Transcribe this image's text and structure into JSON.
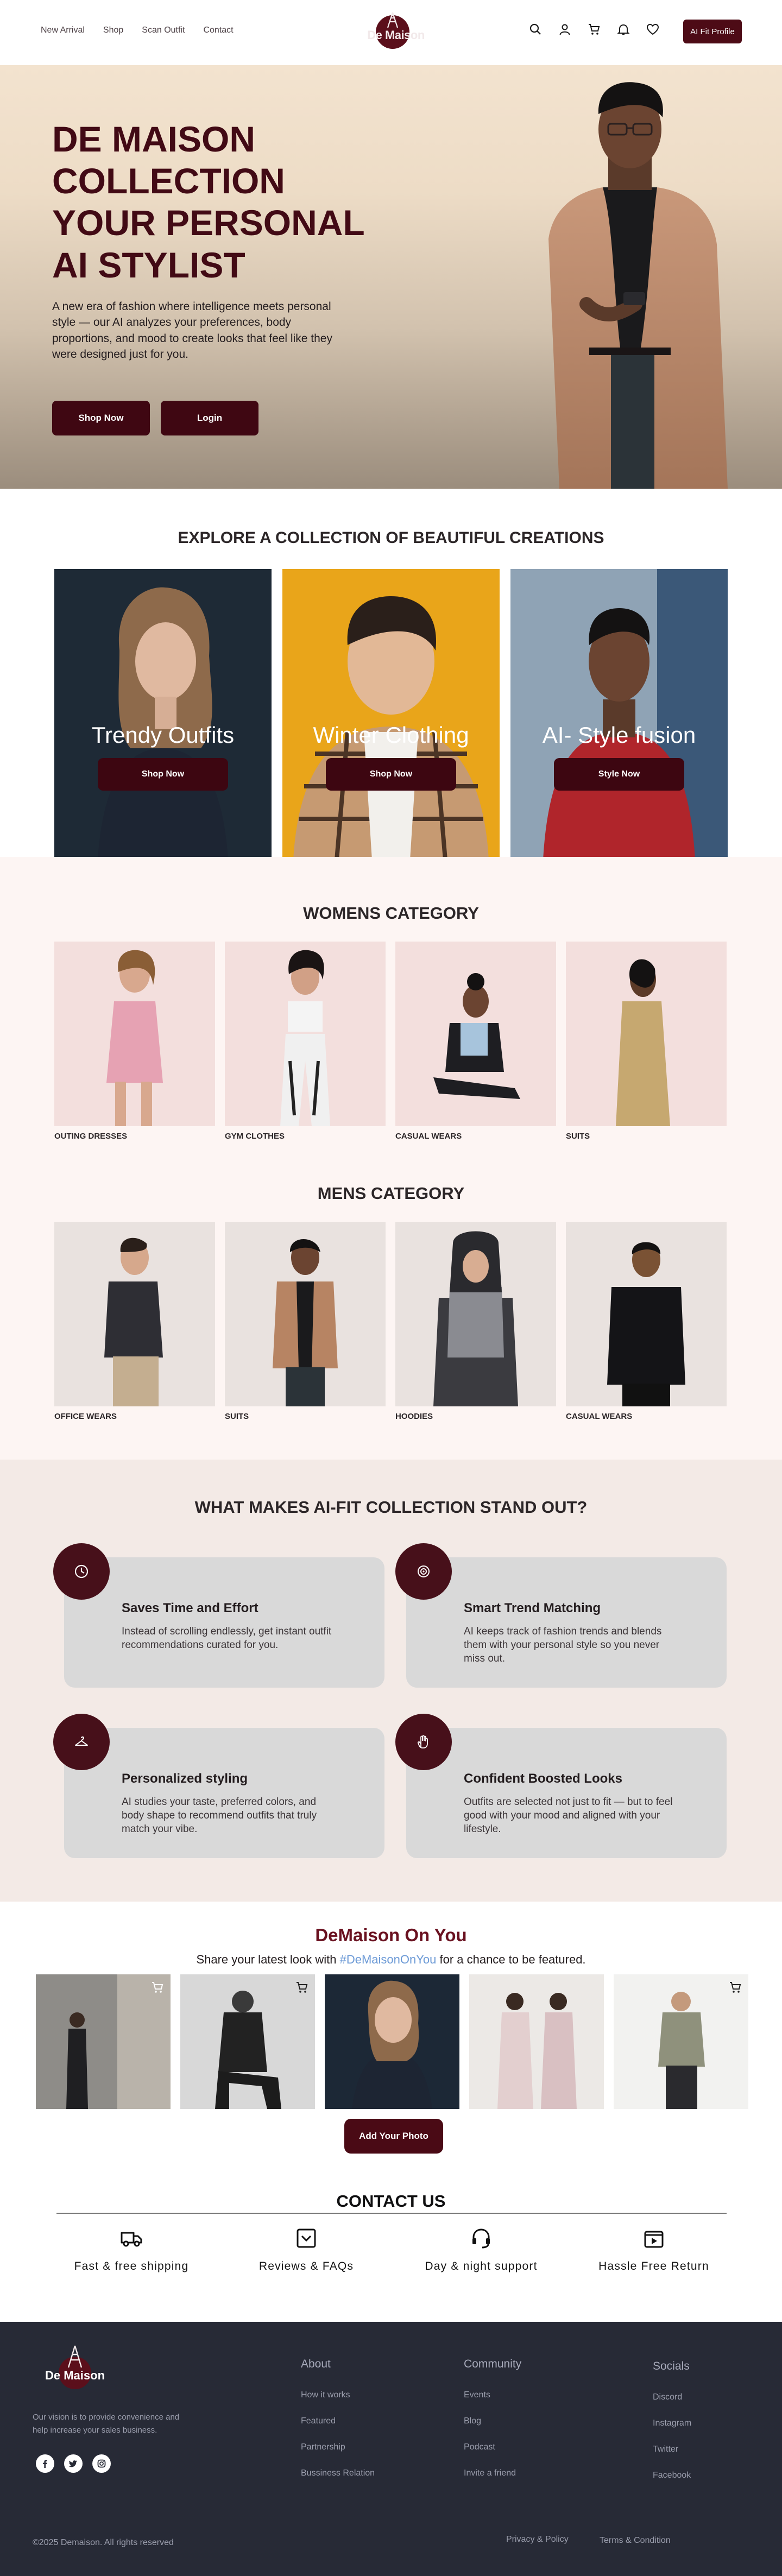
{
  "nav": {
    "links": [
      "New Arrival",
      "Shop",
      "Scan Outfit",
      "Contact"
    ],
    "logo_text": "De Maison",
    "profile_button": "AI Fit Profile",
    "icons": [
      "search-icon",
      "user-icon",
      "cart-icon",
      "bell-icon",
      "heart-icon"
    ]
  },
  "hero": {
    "title_lines": [
      "DE MAISON",
      "COLLECTION",
      "YOUR PERSONAL",
      "AI STYLIST"
    ],
    "subtitle": "A new era of fashion where intelligence meets personal style — our AI analyzes your preferences, body proportions, and mood to create looks that feel like they were designed just for you.",
    "buttons": [
      "Shop Now",
      "Login"
    ]
  },
  "explore": {
    "title": "EXPLORE A COLLECTION OF BEAUTIFUL CREATIONS",
    "cards": [
      {
        "label": "Trendy Outfits",
        "button": "Shop Now"
      },
      {
        "label": "Winter Clothing",
        "button": "Shop Now"
      },
      {
        "label": "AI- Style fusion",
        "button": "Style Now"
      }
    ]
  },
  "womens": {
    "title": "WOMENS CATEGORY",
    "items": [
      "OUTING DRESSES",
      "GYM CLOTHES",
      "CASUAL WEARS",
      "SUITS"
    ]
  },
  "mens": {
    "title": "MENS CATEGORY",
    "items": [
      "OFFICE WEARS",
      "SUITS",
      "HOODIES",
      "CASUAL WEARS"
    ]
  },
  "features": {
    "title": "WHAT MAKES  AI-FIT COLLECTION STAND OUT?",
    "cards": [
      {
        "title": "Saves Time and Effort",
        "text": "Instead of scrolling endlessly, get instant outfit recommendations curated for you.",
        "icon": "clock-icon"
      },
      {
        "title": "Smart Trend Matching",
        "text": "AI keeps track of fashion trends and blends them with your personal style so you never miss out.",
        "icon": "target-icon"
      },
      {
        "title": "Personalized styling",
        "text": "AI studies your taste, preferred colors, and body shape to recommend outfits that truly match your vibe.",
        "icon": "hanger-icon"
      },
      {
        "title": "Confident Boosted Looks",
        "text": "Outfits are selected not just to fit — but to feel good with your mood and aligned with your lifestyle.",
        "icon": "hand-icon"
      }
    ]
  },
  "gallery": {
    "title": "DeMaison On You",
    "subtitle_before": "Share your latest look with ",
    "hashtag": "#DeMaisonOnYou",
    "subtitle_after": " for a chance to be featured.",
    "button": "Add Your Photo"
  },
  "contact": {
    "title": "CONTACT US",
    "items": [
      {
        "label": "Fast & free shipping",
        "icon": "truck-icon"
      },
      {
        "label": "Reviews & FAQs",
        "icon": "inbox-icon"
      },
      {
        "label": "Day & night support",
        "icon": "headset-icon"
      },
      {
        "label": "Hassle Free Return",
        "icon": "play-box-icon"
      }
    ]
  },
  "footer": {
    "logo_text": "De Maison",
    "tagline": "Our vision is to provide convenience and help increase your sales business.",
    "columns": [
      {
        "heading": "About",
        "links": [
          "How it works",
          "Featured",
          "Partnership",
          "Bussiness Relation"
        ]
      },
      {
        "heading": "Community",
        "links": [
          "Events",
          "Blog",
          "Podcast",
          "Invite a friend"
        ]
      },
      {
        "heading": "Socials",
        "links": [
          "Discord",
          "Instagram",
          "Twitter",
          "Facebook"
        ]
      }
    ],
    "copyright": "©2025 Demaison. All rights reserved",
    "bottom_links": [
      "Privacy & Policy",
      "Terms & Condition"
    ]
  },
  "colors": {
    "brand": "#4d0b16",
    "footer": "#272a36",
    "hashtag": "#6c9ad6"
  }
}
